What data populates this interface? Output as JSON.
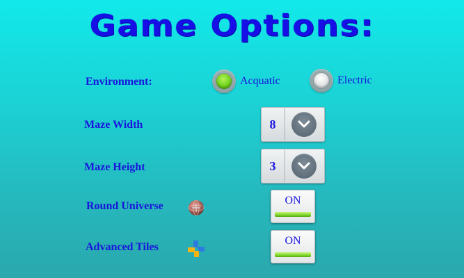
{
  "title": "Game Options:",
  "environment": {
    "label": "Environment:",
    "options": [
      {
        "label": "Acquatic",
        "selected": true
      },
      {
        "label": "Electric",
        "selected": false
      }
    ]
  },
  "maze_width": {
    "label": "Maze Width",
    "value": "8"
  },
  "maze_height": {
    "label": "Maze Height",
    "value": "3"
  },
  "round_universe": {
    "label": "Round Universe",
    "state": "ON",
    "icon": "globe-icon"
  },
  "advanced_tiles": {
    "label": "Advanced Tiles",
    "state": "ON",
    "icon": "tiles-icon"
  },
  "colors": {
    "text": "#1a14dc",
    "title": "#1710e6",
    "on_green": "#6ed21a"
  }
}
